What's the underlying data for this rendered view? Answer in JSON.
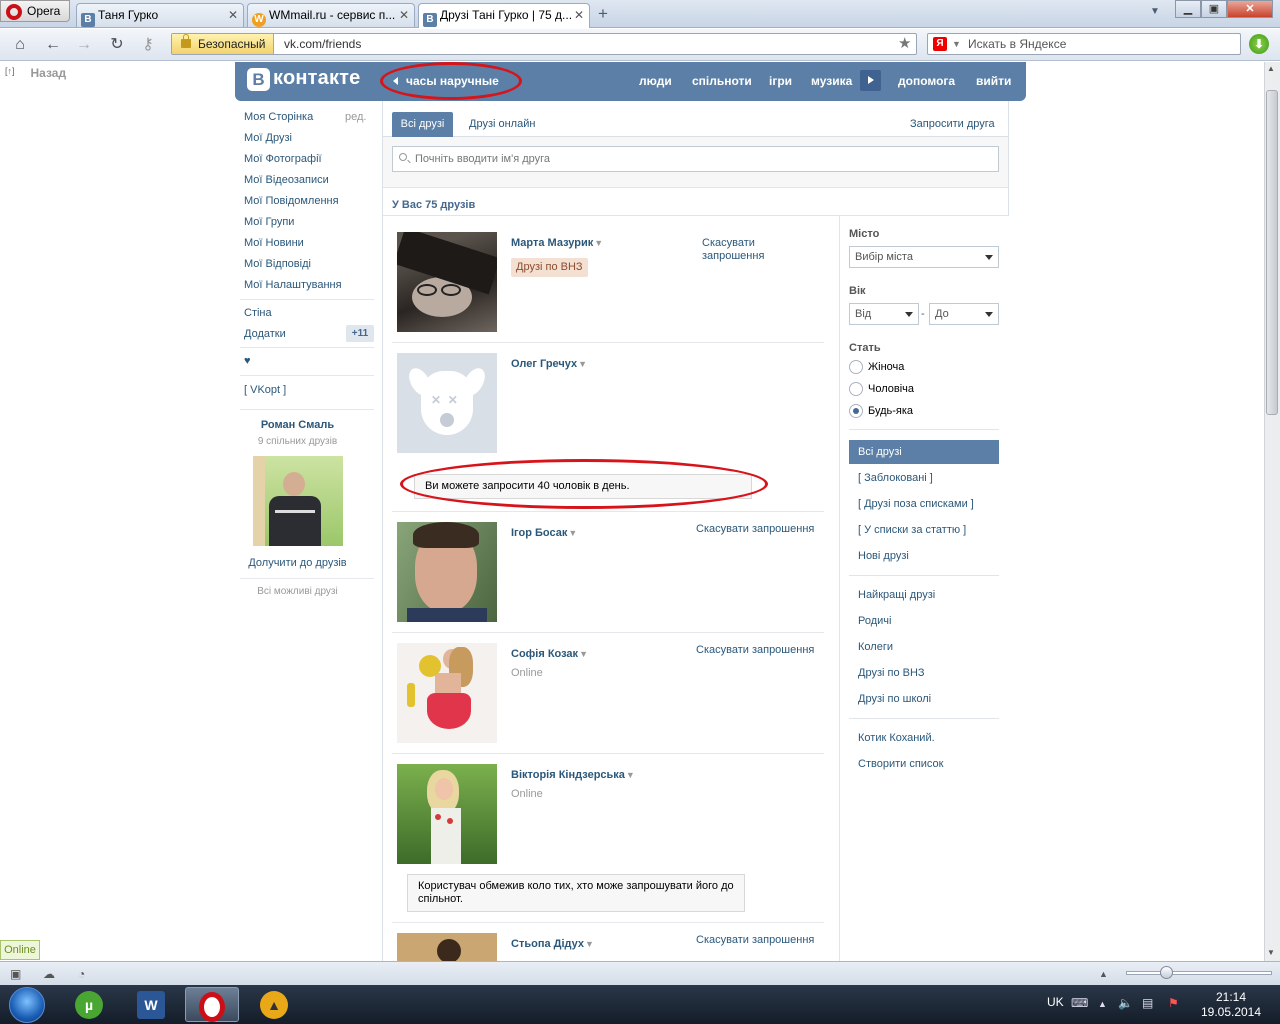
{
  "browser": {
    "menu_label": "Opera",
    "tabs": [
      {
        "label": "Таня Гурко",
        "icon": "В"
      },
      {
        "label": "WMmail.ru - сервис п...",
        "icon": "W"
      },
      {
        "label": "Друзі Тані Гурко | 75 д...",
        "icon": "В"
      }
    ],
    "new_tab": "+",
    "secure_label": "Безопасный",
    "url": "vk.com/friends",
    "search_placeholder": "Искать в Яндексе",
    "search_engine_icon": "Я"
  },
  "page": {
    "back_label": "Назад",
    "back_icon": "[↑]",
    "header": {
      "logo_letter": "В",
      "logo_text": "контакте",
      "status_text": "часы наручные",
      "nav": [
        "люди",
        "спільноти",
        "ігри",
        "музика",
        "допомога",
        "вийти"
      ]
    },
    "left_menu": {
      "items": [
        "Моя Сторінка",
        "Мої Друзі",
        "Мої Фотографії",
        "Мої Відеозаписи",
        "Мої Повідомлення",
        "Мої Групи",
        "Мої Новини",
        "Мої Відповіді",
        "Мої Налаштування"
      ],
      "edit_label": "ред.",
      "wall": "Стіна",
      "apps": "Додатки",
      "apps_badge": "+11",
      "heart": "♥",
      "vkopt": "[ VKopt ]",
      "suggest_name": "Роман Смаль",
      "suggest_common": "9 спільних друзів",
      "suggest_add": "Долучити до друзів",
      "suggest_all": "Всі можливі друзі"
    },
    "tabs": {
      "all": "Всі друзі",
      "online": "Друзі онлайн",
      "invite": "Запросити друга"
    },
    "search_placeholder": "Почніть вводити ім'я друга",
    "count_text": "У Вас 75 друзів",
    "friends": [
      {
        "name": "Марта Мазурик",
        "tag": "Друзі по ВНЗ",
        "action": "Скасувати запрошення"
      },
      {
        "name": "Олег Гречух",
        "notice": "Ви можете запросити 40 чоловік в день."
      },
      {
        "name": "Ігор Босак",
        "action": "Скасувати запрошення"
      },
      {
        "name": "Софія Козак",
        "sub": "Online",
        "action": "Скасувати запрошення"
      },
      {
        "name": "Вікторія Кіндзерська",
        "sub": "Online",
        "notice": "Користувач обмежив коло тих, хто може запрошувати його до спільнот."
      },
      {
        "name": "Стьопа Дідух",
        "action": "Скасувати запрошення"
      }
    ],
    "filter": {
      "city_label": "Місто",
      "city_placeholder": "Вибір міста",
      "age_label": "Вік",
      "age_from": "Від",
      "age_dash": "-",
      "age_to": "До",
      "sex_label": "Стать",
      "sex_options": [
        "Жіноча",
        "Чоловіча",
        "Будь-яка"
      ],
      "lists": [
        "Всі друзі",
        "[ Заблоковані ]",
        "[ Друзі поза списками ]",
        "[ У списки за статтю ]",
        "Нові друзі"
      ],
      "groups": [
        "Найкращі друзі",
        "Родичі",
        "Колеги",
        "Друзі по ВНЗ",
        "Друзі по школі"
      ],
      "custom": [
        "Котик Коханий.",
        "Створити список"
      ]
    }
  },
  "status": {
    "online_badge": "Online"
  },
  "taskbar": {
    "lang": "UK",
    "time": "21:14",
    "date": "19.05.2014"
  },
  "colors": {
    "vk_blue": "#5b7fa6",
    "link": "#2b587a",
    "annotation_red": "#d6141a"
  }
}
